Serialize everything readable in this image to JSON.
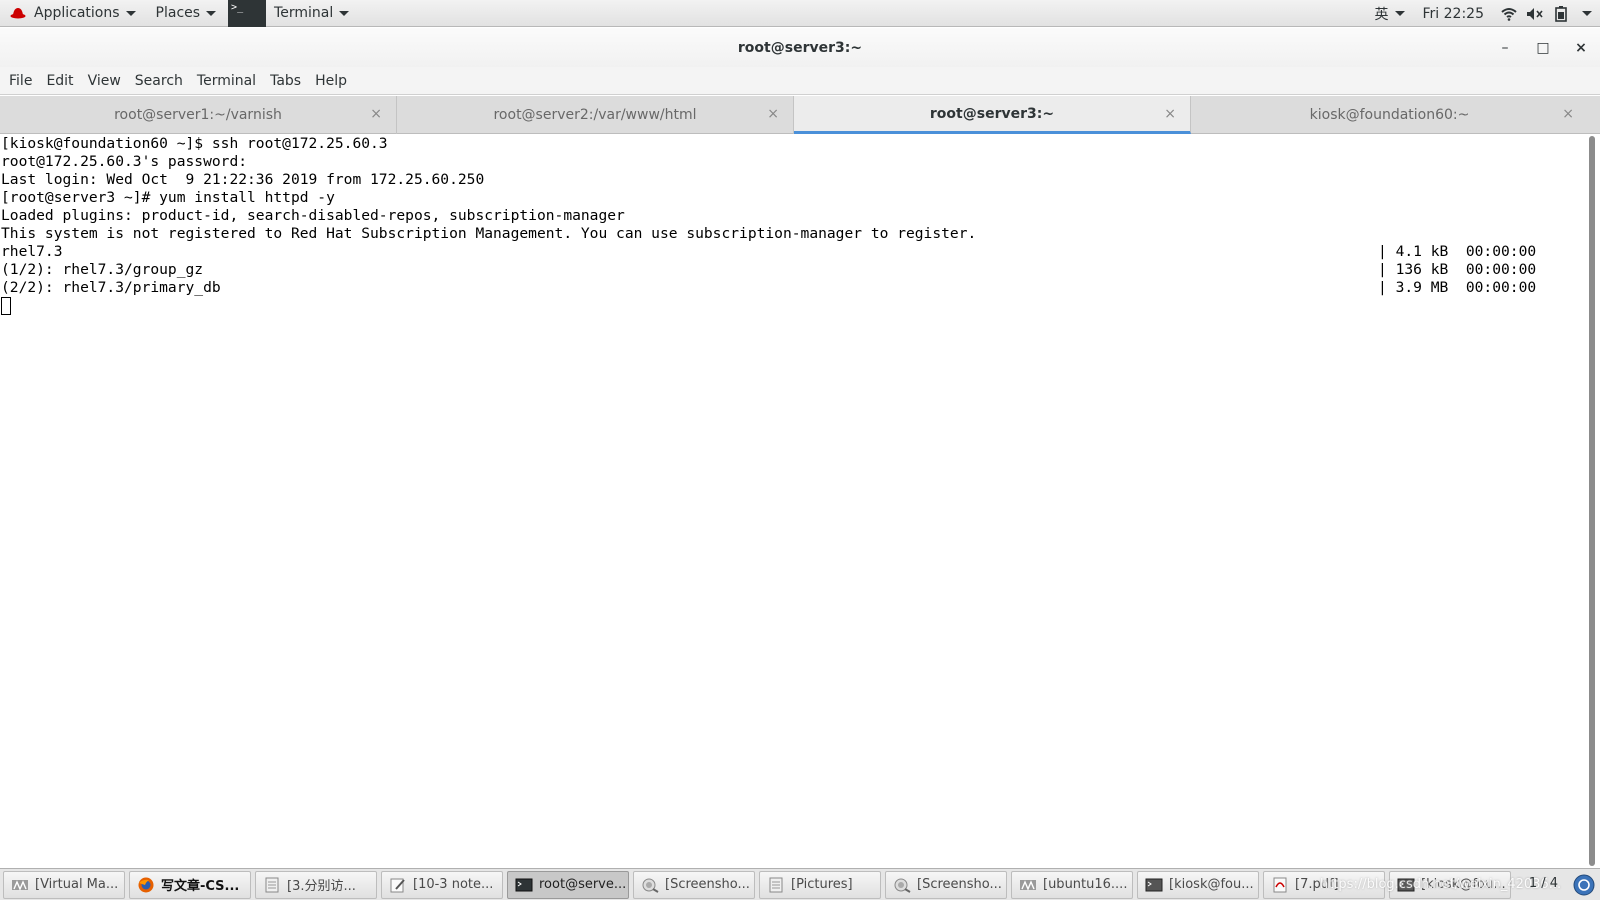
{
  "topbar": {
    "applications_label": "Applications",
    "places_label": "Places",
    "terminal_label": "Terminal",
    "input_method": "英",
    "clock": "Fri 22:25"
  },
  "window": {
    "title": "root@server3:~",
    "minimize": "–",
    "maximize": "□",
    "close": "×"
  },
  "menubar": {
    "items": [
      "File",
      "Edit",
      "View",
      "Search",
      "Terminal",
      "Tabs",
      "Help"
    ]
  },
  "tabs": [
    {
      "label": "root@server1:~/varnish",
      "active": false
    },
    {
      "label": "root@server2:/var/www/html",
      "active": false
    },
    {
      "label": "root@server3:~",
      "active": true
    },
    {
      "label": "kiosk@foundation60:~",
      "active": false
    }
  ],
  "tab_close_glyph": "×",
  "terminal": {
    "lines": [
      {
        "text": "[kiosk@foundation60 ~]$ ssh root@172.25.60.3",
        "right": ""
      },
      {
        "text": "root@172.25.60.3's password:",
        "right": ""
      },
      {
        "text": "Last login: Wed Oct  9 21:22:36 2019 from 172.25.60.250",
        "right": ""
      },
      {
        "text": "[root@server3 ~]# yum install httpd -y",
        "right": ""
      },
      {
        "text": "Loaded plugins: product-id, search-disabled-repos, subscription-manager",
        "right": ""
      },
      {
        "text": "This system is not registered to Red Hat Subscription Management. You can use subscription-manager to register.",
        "right": ""
      },
      {
        "text": "rhel7.3",
        "right": "| 4.1 kB  00:00:00"
      },
      {
        "text": "(1/2): rhel7.3/group_gz",
        "right": "| 136 kB  00:00:00"
      },
      {
        "text": "(2/2): rhel7.3/primary_db",
        "right": "| 3.9 MB  00:00:00"
      }
    ]
  },
  "taskbar": {
    "items": [
      {
        "label": "[Virtual Ma...",
        "icon": "virt-manager-icon",
        "active": false
      },
      {
        "label": "写文章-CS...",
        "icon": "firefox-icon",
        "active": false
      },
      {
        "label": "[3.分别访...",
        "icon": "document-icon",
        "active": false
      },
      {
        "label": "[10-3 note...",
        "icon": "text-editor-icon",
        "active": false
      },
      {
        "label": "root@serve...",
        "icon": "terminal-icon",
        "active": true
      },
      {
        "label": "[Screensho...",
        "icon": "screenshot-icon",
        "active": false
      },
      {
        "label": "[Pictures]",
        "icon": "folder-icon",
        "active": false
      },
      {
        "label": "[Screensho...",
        "icon": "screenshot-icon",
        "active": false
      },
      {
        "label": "[ubuntu16....",
        "icon": "virt-manager-icon",
        "active": false
      },
      {
        "label": "[kiosk@fou...",
        "icon": "terminal-icon",
        "active": false
      },
      {
        "label": "[7.pdf]",
        "icon": "pdf-icon",
        "active": false
      },
      {
        "label": "[kiosk@fou...",
        "icon": "terminal-icon",
        "active": false
      }
    ],
    "pager": "1 / 4",
    "watermark": "https://blog.csdn.net/weixin_42036..."
  },
  "colors": {
    "tab_active_underline": "#4a90d9",
    "terminal_bg": "#ffffff",
    "terminal_fg": "#000000"
  }
}
